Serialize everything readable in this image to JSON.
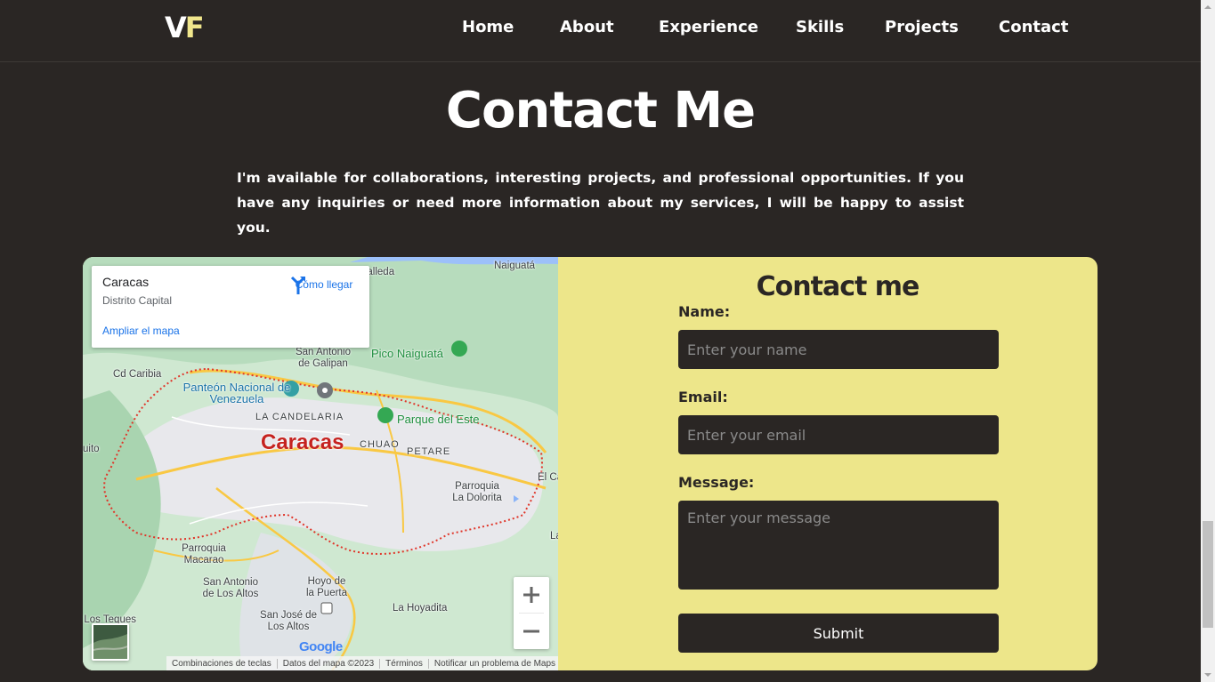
{
  "nav": {
    "logo_v": "V",
    "logo_f": "F",
    "links": [
      "Home",
      "About",
      "Experience",
      "Skills",
      "Projects",
      "Contact"
    ]
  },
  "hero": {
    "title": "Contact Me",
    "intro": "I'm available for collaborations, interesting projects, and professional opportunities. If you have any inquiries or need more information about my services, I will be happy to assist you."
  },
  "map": {
    "place_name": "Caracas",
    "place_sub": "Distrito Capital",
    "directions_label": "Cómo llegar",
    "expand_label": "Ampliar el mapa",
    "labels": {
      "cd_caribia": "Cd Caribia",
      "san_antonio": "San Antonio de Galipan",
      "pico": "Pico Naiguatá",
      "naiguata": "Naiguatá",
      "panteon": "Panteón Nacional de Venezuela",
      "candelaria": "LA CANDELARIA",
      "parque": "Parque del Este",
      "city": "Caracas",
      "chuao": "CHUAO",
      "petare": "PETARE",
      "dolorita": "Parroquia La Dolorita",
      "el_c": "El Ca",
      "macarao": "Parroquia Macarao",
      "los_altos": "San Antonio de Los Altos",
      "hoyo": "Hoyo de la Puerta",
      "hoyadita": "La Hoyadita",
      "teques": "Los Teques",
      "san_jose": "San José de Los Altos",
      "uito": "uito",
      "alleda": "balleda",
      "la": "La"
    },
    "google": "Google",
    "attribution": [
      "Combinaciones de teclas",
      "Datos del mapa ©2023",
      "Términos",
      "Notificar un problema de Maps"
    ]
  },
  "form": {
    "title": "Contact me",
    "name_label": "Name:",
    "name_placeholder": "Enter your name",
    "email_label": "Email:",
    "email_placeholder": "Enter your email",
    "message_label": "Message:",
    "message_placeholder": "Enter your message",
    "submit_label": "Submit"
  },
  "colors": {
    "background": "#2a2624",
    "accent": "#ede68a",
    "logo_accent": "#f0e68c"
  }
}
